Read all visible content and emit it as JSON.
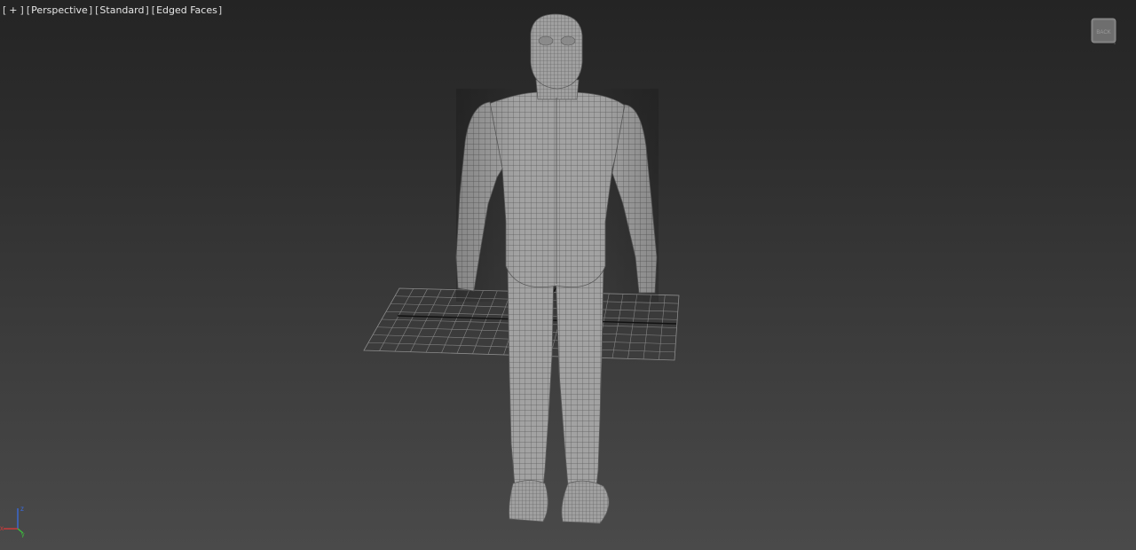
{
  "viewport": {
    "labels": [
      {
        "text": "+",
        "name": "viewport-menu-button"
      },
      {
        "text": "Perspective",
        "name": "point-of-view-label"
      },
      {
        "text": "Standard",
        "name": "shading-mode-label"
      },
      {
        "text": "Edged Faces",
        "name": "display-mode-label"
      }
    ],
    "viewcube_face": "BACK",
    "axis": {
      "x": "x",
      "y": "y",
      "z": "z"
    },
    "colors": {
      "background_top": "#242424",
      "background_bottom": "#4a4a4a",
      "mesh_fill": "#9a9a9a",
      "wire": "#5a5a5a",
      "grid": "#8c8c8c",
      "axis_x": "#d03a3a",
      "axis_y": "#3cbf3c",
      "axis_z": "#3a6ad8"
    }
  }
}
